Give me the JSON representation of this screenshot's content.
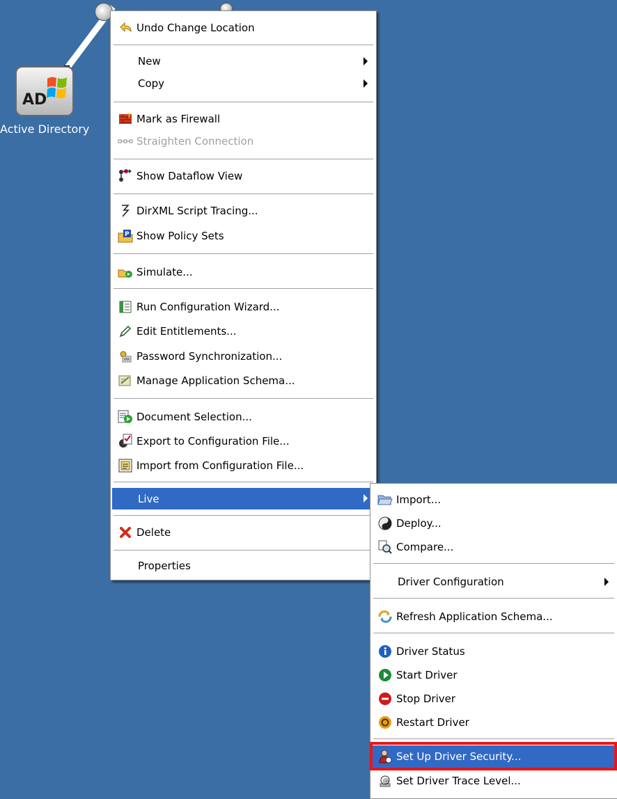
{
  "canvas": {
    "background": "#3a6ea5",
    "node_label": "Active Directory",
    "ad_icon_text": "AD"
  },
  "main_menu": {
    "items": [
      {
        "label": "Undo Change Location",
        "icon": "undo-icon"
      },
      {
        "label": "New",
        "icon": "",
        "submenu": true
      },
      {
        "label": "Copy",
        "icon": "",
        "submenu": true
      },
      {
        "label": "Mark as Firewall",
        "icon": "firewall-icon"
      },
      {
        "label": "Straighten Connection",
        "icon": "straighten-icon",
        "disabled": true
      },
      {
        "label": "Show Dataflow View",
        "icon": "dataflow-icon"
      },
      {
        "label": "DirXML Script Tracing...",
        "icon": "tracing-icon"
      },
      {
        "label": "Show Policy Sets",
        "icon": "policy-sets-icon"
      },
      {
        "label": "Simulate...",
        "icon": "simulate-icon"
      },
      {
        "label": "Run Configuration Wizard...",
        "icon": "wizard-icon"
      },
      {
        "label": "Edit Entitlements...",
        "icon": "entitlements-icon"
      },
      {
        "label": "Password Synchronization...",
        "icon": "password-sync-icon"
      },
      {
        "label": "Manage Application Schema...",
        "icon": "schema-icon"
      },
      {
        "label": "Document Selection...",
        "icon": "document-icon"
      },
      {
        "label": "Export to Configuration File...",
        "icon": "export-icon"
      },
      {
        "label": "Import from Configuration File...",
        "icon": "import-config-icon"
      },
      {
        "label": "Live",
        "icon": "",
        "submenu": true,
        "selected": true
      },
      {
        "label": "Delete",
        "icon": "delete-icon"
      },
      {
        "label": "Properties",
        "icon": ""
      }
    ]
  },
  "live_submenu": {
    "items": [
      {
        "label": "Import...",
        "icon": "folder-open-icon"
      },
      {
        "label": "Deploy...",
        "icon": "deploy-icon"
      },
      {
        "label": "Compare...",
        "icon": "compare-icon"
      },
      {
        "label": "Driver Configuration",
        "icon": "",
        "submenu": true
      },
      {
        "label": "Refresh Application Schema...",
        "icon": "refresh-schema-icon"
      },
      {
        "label": "Driver Status",
        "icon": "info-icon"
      },
      {
        "label": "Start Driver",
        "icon": "start-icon"
      },
      {
        "label": "Stop Driver",
        "icon": "stop-icon"
      },
      {
        "label": "Restart Driver",
        "icon": "restart-icon"
      },
      {
        "label": "Set Up Driver Security...",
        "icon": "security-user-icon",
        "selected": true
      },
      {
        "label": "Set Driver Trace Level...",
        "icon": "trace-level-icon"
      }
    ]
  },
  "colors": {
    "selection": "#316ac5",
    "highlight_border": "#e8161b"
  }
}
